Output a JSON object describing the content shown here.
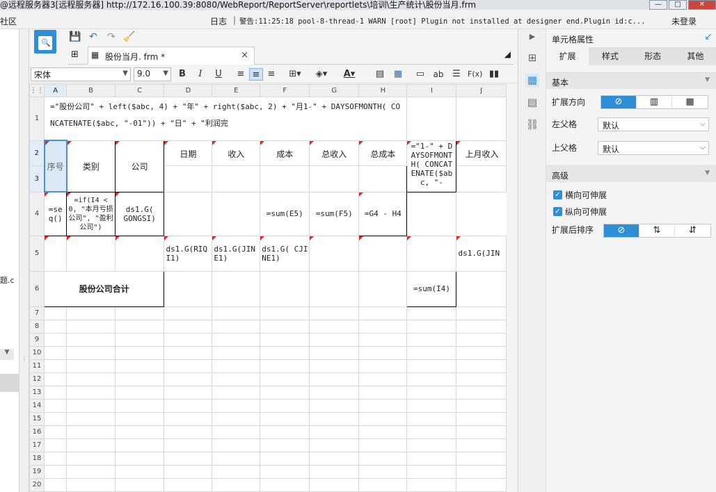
{
  "window": {
    "title": "@远程服务器3[远程服务器]    http://172.16.100.39:8080/WebReport/ReportServer\\reportlets\\培训\\生产统计\\股份当月.frm"
  },
  "menubar": {
    "community": "社区",
    "log": "日志",
    "sep": "|",
    "warning": "警告:11:25:18 pool-8-thread-1 WARN [root] Plugin not installed at designer end.Plugin id:c...",
    "login": "未登录"
  },
  "leftpanel": {
    "fragment": "题.c"
  },
  "tab": {
    "label": "股份当月. frm *",
    "close": "×"
  },
  "format": {
    "font": "宋体",
    "size": "9.0"
  },
  "sheet": {
    "columns": [
      "A",
      "B",
      "C",
      "D",
      "E",
      "F",
      "G",
      "H",
      "I",
      "J"
    ],
    "rows": [
      "1",
      "2",
      "3",
      "4",
      "5",
      "6",
      "7",
      "8",
      "9",
      "10",
      "11",
      "12",
      "13",
      "14",
      "15",
      "16",
      "17",
      "18",
      "19",
      "20"
    ],
    "formula1": "=\"股份公司\" + left($abc, 4) + \"年\" + right($abc, 2) + \"月1-\" + DAYSOFMONTH( CONCATENATE($abc, \"-01\")) + \"日\" + \"利润完",
    "seq": "序号",
    "category": "类别",
    "company": "公司",
    "date": "日期",
    "income": "收入",
    "cost": "成本",
    "total_income": "总收入",
    "total_cost": "总成本",
    "i2": "=\"1-\" + DAYSOFMONTH( CONCATENATE($abc, \"-",
    "last_income": "上月收入",
    "a4": "=seq()",
    "b4": "=if(I4 < 0, \"本月亏损公司\", \"盈利公司\")",
    "c4": "ds1.G( GONGSI)",
    "g4": "=sum(E5)",
    "h4": "=sum(F5)",
    "i4": "=G4 - H4",
    "d5": "ds1.G(RIQI1)",
    "e5": "ds1.G(JINE1)",
    "f5": "ds1.G( CJINE1)",
    "j5": "ds1.G(JIN",
    "a6": "股份公司合计",
    "i6": "=sum(I4)"
  },
  "props": {
    "title": "单元格属性",
    "tabs": [
      "扩展",
      "样式",
      "形态",
      "其他"
    ],
    "basic": "基本",
    "expand_dir": "扩展方向",
    "left_parent": "左父格",
    "top_parent": "上父格",
    "default": "默认",
    "advanced": "高级",
    "h_expand": "横向可伸展",
    "v_expand": "纵向可伸展",
    "sort_after": "扩展后排序"
  }
}
